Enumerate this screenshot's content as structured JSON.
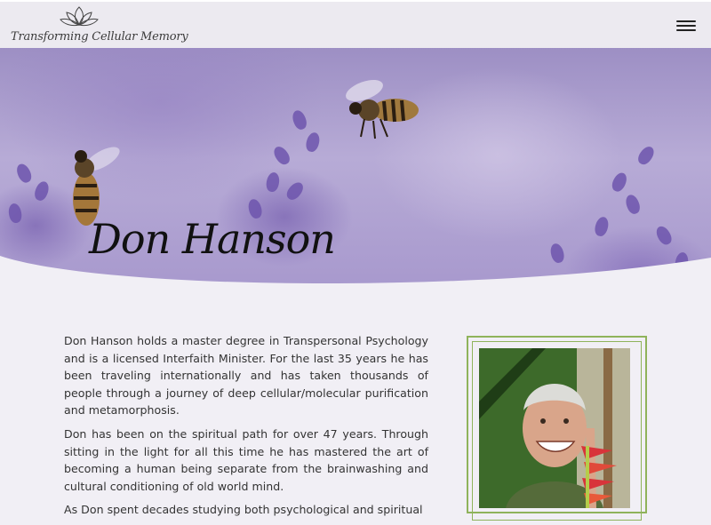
{
  "header": {
    "logo_text": "Transforming Cellular Memory",
    "logo_icon": "lotus-icon",
    "menu_icon": "hamburger-menu-icon"
  },
  "hero": {
    "title": "Don Hanson"
  },
  "bio": {
    "paragraphs": [
      "Don Hanson holds a master degree in Transpersonal Psychology and is a licensed Interfaith Minister. For the last 35 years he has been traveling internationally and has taken thousands of people through a journey of deep cellular/molecular purification and metamorphosis.",
      "Don has been on the spiritual path for over 47 years.  Through sitting in the light for all this time he has mastered the art of becoming a human being separate from the brainwashing and cultural conditioning of old world mind.",
      "As Don spent decades studying both psychological and spiritual"
    ]
  },
  "colors": {
    "accent_green": "#8fb35b",
    "background": "#f1eff5",
    "hero_lavender": "#a798cd"
  }
}
